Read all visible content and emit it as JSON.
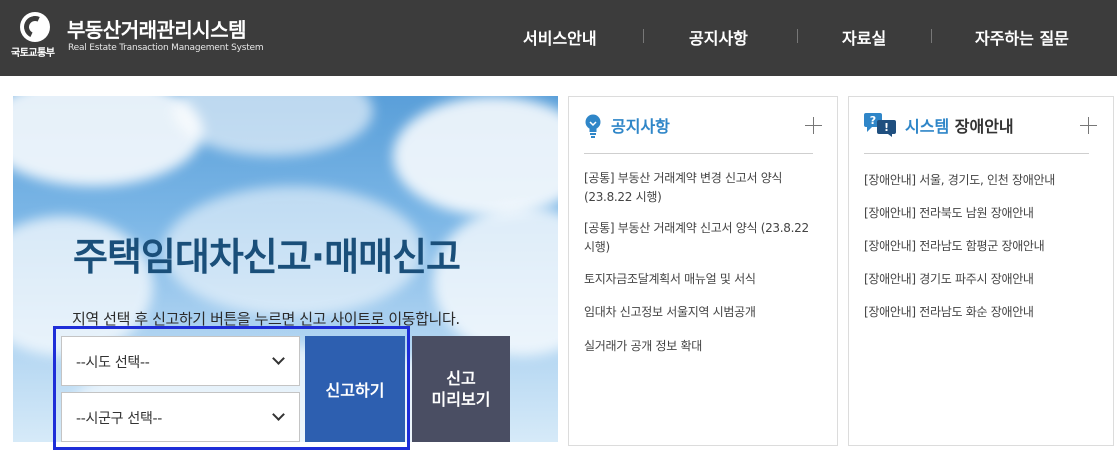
{
  "header": {
    "ministry": "국토교통부",
    "title": "부동산거래관리시스템",
    "subtitle": "Real Estate Transaction Management System",
    "nav": [
      "서비스안내",
      "공지사항",
      "자료실",
      "자주하는 질문"
    ]
  },
  "hero": {
    "title": "주택임대차신고·매매신고",
    "description": "지역 선택 후 신고하기 버튼을 누르면 신고 사이트로 이동합니다.",
    "sido_select": "--시도 선택--",
    "sigungu_select": "--시군구 선택--",
    "report_button": "신고하기",
    "preview_line1": "신고",
    "preview_line2": "미리보기"
  },
  "notice": {
    "title": "공지사항",
    "items": [
      "[공통] 부동산 거래계약 변경 신고서 양식 (23.8.22 시행)",
      "[공통] 부동산 거래계약 신고서 양식 (23.8.22 시행)",
      "토지자금조달계획서 매뉴얼 및 서식",
      "임대차 신고정보 서울지역 시범공개",
      "실거래가 공개 정보 확대"
    ]
  },
  "system": {
    "title_accent": "시스템",
    "title_rest": "장애안내",
    "items": [
      "[장애안내] 서울, 경기도, 인천 장애안내",
      "[장애안내] 전라북도 남원 장애안내",
      "[장애안내] 전라남도 함평군 장애안내",
      "[장애안내] 경기도 파주시 장애안내",
      "[장애안내] 전라남도 화순 장애안내"
    ]
  },
  "colors": {
    "header_bg": "#3c3c3c",
    "accent_blue": "#2f86c8",
    "report_button": "#2d5fb0",
    "preview_button": "#4a4e63",
    "focus_frame": "#1e2ed8"
  }
}
